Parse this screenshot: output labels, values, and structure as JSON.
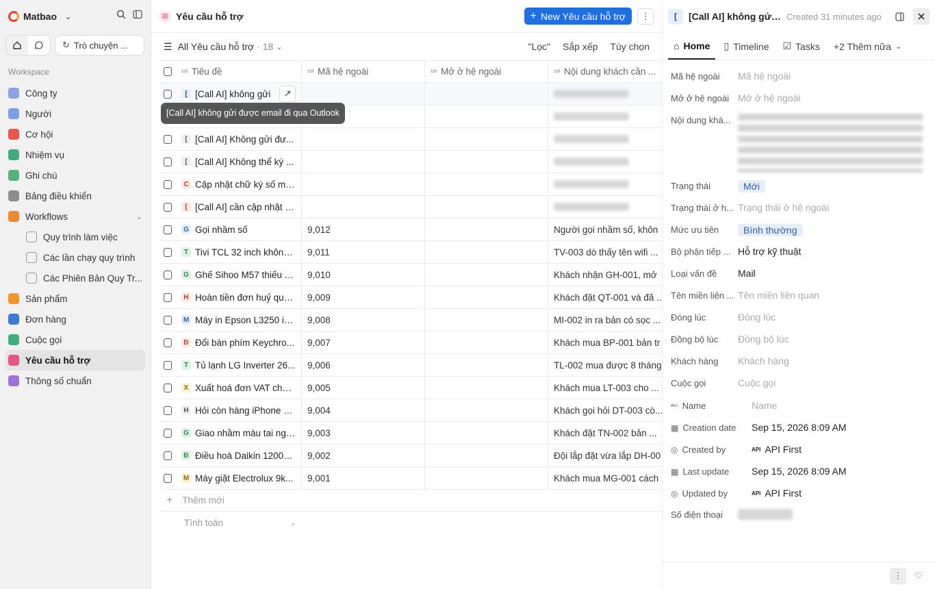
{
  "workspace": {
    "name": "Matbao",
    "chat_label": "Trò chuyện ...",
    "section_label": "Workspace"
  },
  "nav": [
    {
      "label": "Công ty",
      "color": "#8aa4e0",
      "sub": false,
      "active": false
    },
    {
      "label": "Người",
      "color": "#7ba0e6",
      "sub": false,
      "active": false
    },
    {
      "label": "Cơ hội",
      "color": "#e8564a",
      "sub": false,
      "active": false
    },
    {
      "label": "Nhiệm vụ",
      "color": "#3fae7a",
      "sub": false,
      "active": false
    },
    {
      "label": "Ghi chú",
      "color": "#55b27f",
      "sub": false,
      "active": false
    },
    {
      "label": "Bảng điều khiển",
      "color": "#8c8c8c",
      "sub": false,
      "active": false
    },
    {
      "label": "Workflows",
      "color": "#f08a2b",
      "sub": false,
      "active": false
    },
    {
      "label": "Quy trình làm việc",
      "color": "#9a9a9a",
      "sub": true,
      "active": false
    },
    {
      "label": "Các lần chạy quy trình",
      "color": "#9a9a9a",
      "sub": true,
      "active": false
    },
    {
      "label": "Các Phiên Bản Quy Tr...",
      "color": "#9a9a9a",
      "sub": true,
      "active": false
    },
    {
      "label": "Sản phẩm",
      "color": "#f0962b",
      "sub": false,
      "active": false
    },
    {
      "label": "Đơn hàng",
      "color": "#3a7bd8",
      "sub": false,
      "active": false
    },
    {
      "label": "Cuộc gọi",
      "color": "#3fae7a",
      "sub": false,
      "active": false
    },
    {
      "label": "Yêu cầu hỗ trợ",
      "color": "#e8548a",
      "sub": false,
      "active": true
    },
    {
      "label": "Thông số chuẩn",
      "color": "#a070d8",
      "sub": false,
      "active": false
    }
  ],
  "main": {
    "title": "Yêu cầu hỗ trợ",
    "new_button": "New Yêu cầu hỗ trợ",
    "view_name": "All Yêu cầu hỗ trợ",
    "view_count": "· 18",
    "filter": "\"Lọc\"",
    "sort": "Sắp xếp",
    "options": "Tùy chọn",
    "columns": [
      "Tiêu đề",
      "Mã hệ ngoài",
      "Mở ở hệ ngoài",
      "Nội dung khách cần ..."
    ],
    "tooltip": "[Call AI] không gửi được email đi qua Outlook",
    "add_new": "Thêm mới",
    "calc": "Tính toán"
  },
  "rows": [
    {
      "letter": "[",
      "bg": "#e6eefc",
      "fg": "#2b4a8a",
      "title": "[Call AI] không gửi",
      "code": "",
      "content": "",
      "blur": true
    },
    {
      "letter": "",
      "bg": "#fff",
      "fg": "#fff",
      "title": "",
      "code": "",
      "content": "",
      "blur": true
    },
    {
      "letter": "[",
      "bg": "#f0f0f0",
      "fg": "#555",
      "title": "[Call AI] Không gửi đư...",
      "code": "",
      "content": "",
      "blur": true
    },
    {
      "letter": "[",
      "bg": "#f0f0f0",
      "fg": "#555",
      "title": "[Call AI] Không thể ký ...",
      "code": "",
      "content": "",
      "blur": true
    },
    {
      "letter": "C",
      "bg": "#fde8e2",
      "fg": "#b5442c",
      "title": "Cập nhật chữ ký số mớ...",
      "code": "",
      "content": "",
      "blur": true
    },
    {
      "letter": "[",
      "bg": "#fde8e2",
      "fg": "#b5442c",
      "title": "[Call AI] cần cập nhật c...",
      "code": "",
      "content": "",
      "blur": true
    },
    {
      "letter": "G",
      "bg": "#e2eefc",
      "fg": "#2b5fb0",
      "title": "Gọi nhầm số",
      "code": "9,012",
      "content": "Người gọi nhầm số, khôn",
      "blur": false
    },
    {
      "letter": "T",
      "bg": "#def3e6",
      "fg": "#2a8a52",
      "title": "Tivi TCL 32 inch không...",
      "code": "9,011",
      "content": "TV-003 dò thấy tên wifi ...",
      "blur": false
    },
    {
      "letter": "G",
      "bg": "#def3e6",
      "fg": "#2a8a52",
      "title": "Ghế Sihoo M57 thiếu ố...",
      "code": "9,010",
      "content": "Khách nhận GH-001, mở",
      "blur": false
    },
    {
      "letter": "H",
      "bg": "#fde8e2",
      "fg": "#b5442c",
      "title": "Hoàn tiền đơn huỷ quạ...",
      "code": "9,009",
      "content": "Khách đặt QT-001 và đã ...",
      "blur": false
    },
    {
      "letter": "M",
      "bg": "#e2eefc",
      "fg": "#2b5fb0",
      "title": "Máy in Epson L3250 in...",
      "code": "9,008",
      "content": "MI-002 in ra bản có sọc ...",
      "blur": false
    },
    {
      "letter": "Đ",
      "bg": "#fde8e2",
      "fg": "#b5442c",
      "title": "Đổi bàn phím Keychro...",
      "code": "9,007",
      "content": "Khách mua BP-001 bản tr",
      "blur": false
    },
    {
      "letter": "T",
      "bg": "#def3e6",
      "fg": "#2a8a52",
      "title": "Tủ lạnh LG Inverter 26...",
      "code": "9,006",
      "content": "TL-002 mua được 8 tháng",
      "blur": false
    },
    {
      "letter": "X",
      "bg": "#fbf4cf",
      "fg": "#8a6a12",
      "title": "Xuất hoá đơn VAT cho ...",
      "code": "9,005",
      "content": "Khách mua LT-003 cho ...",
      "blur": false
    },
    {
      "letter": "H",
      "bg": "#f0f0f0",
      "fg": "#555",
      "title": "Hỏi còn hàng iPhone 1...",
      "code": "9,004",
      "content": "Khách gọi hỏi DT-003 cò...",
      "blur": false
    },
    {
      "letter": "G",
      "bg": "#def3e6",
      "fg": "#2a8a52",
      "title": "Giao nhầm màu tai ngh...",
      "code": "9,003",
      "content": "Khách đặt TN-002 bản ...",
      "blur": false
    },
    {
      "letter": "Đ",
      "bg": "#def3e6",
      "fg": "#2a8a52",
      "title": "Điều hoà Daikin 12000...",
      "code": "9,002",
      "content": "Đội lắp đặt vừa lắp DH-00",
      "blur": false
    },
    {
      "letter": "M",
      "bg": "#fbf4cf",
      "fg": "#8a6a12",
      "title": "Máy giặt Electrolux 9k...",
      "code": "9,001",
      "content": "Khách mua MG-001 cách",
      "blur": false
    }
  ],
  "panel": {
    "badge": "[",
    "title": "[Call AI] không gửi ...",
    "created": "Created 31 minutes ago",
    "tabs": [
      "Home",
      "Timeline",
      "Tasks",
      "+2 Thêm nữa"
    ],
    "fields": [
      {
        "label": "Mã hệ ngoài",
        "value": "Mã hệ ngoài",
        "type": "ph"
      },
      {
        "label": "Mở ở hệ ngoài",
        "value": "Mở ở hệ ngoài",
        "type": "ph"
      },
      {
        "label": "Nội dung khá...",
        "value": "",
        "type": "blur"
      },
      {
        "label": "Trạng thái",
        "value": "Mới",
        "type": "chip",
        "bg": "#e6eefc",
        "fg": "#2b5fb0"
      },
      {
        "label": "Trạng thái ở h...",
        "value": "Trạng thái ở hệ ngoài",
        "type": "ph"
      },
      {
        "label": "Mức ưu tiên",
        "value": "Bình thường",
        "type": "chip",
        "bg": "#e6eefc",
        "fg": "#2b5fb0"
      },
      {
        "label": "Bộ phận tiếp ...",
        "value": "Hỗ trợ kỹ thuật",
        "type": "val"
      },
      {
        "label": "Loại vấn đề",
        "value": "Mail",
        "type": "val"
      },
      {
        "label": "Tên miền liên ...",
        "value": "Tên miền liên quan",
        "type": "ph"
      },
      {
        "label": "Đóng lúc",
        "value": "Đóng lúc",
        "type": "ph"
      },
      {
        "label": "Đồng bộ lúc",
        "value": "Đồng bộ lúc",
        "type": "ph"
      },
      {
        "label": "Khách hàng",
        "value": "Khách hàng",
        "type": "ph"
      },
      {
        "label": "Cuộc gọi",
        "value": "Cuộc gọi",
        "type": "ph"
      }
    ],
    "system_fields": [
      {
        "icon": "Abc",
        "label": "Name",
        "value": "Name",
        "ph": true
      },
      {
        "icon": "cal",
        "label": "Creation date",
        "value": "Sep 15, 2026 8:09 AM",
        "ph": false
      },
      {
        "icon": "user",
        "label": "Created by",
        "value": "API First",
        "ph": false
      },
      {
        "icon": "cal",
        "label": "Last update",
        "value": "Sep 15, 2026 8:09 AM",
        "ph": false
      },
      {
        "icon": "user",
        "label": "Updated by",
        "value": "API First",
        "ph": false
      }
    ],
    "phone_label": "Số điện thoại"
  }
}
